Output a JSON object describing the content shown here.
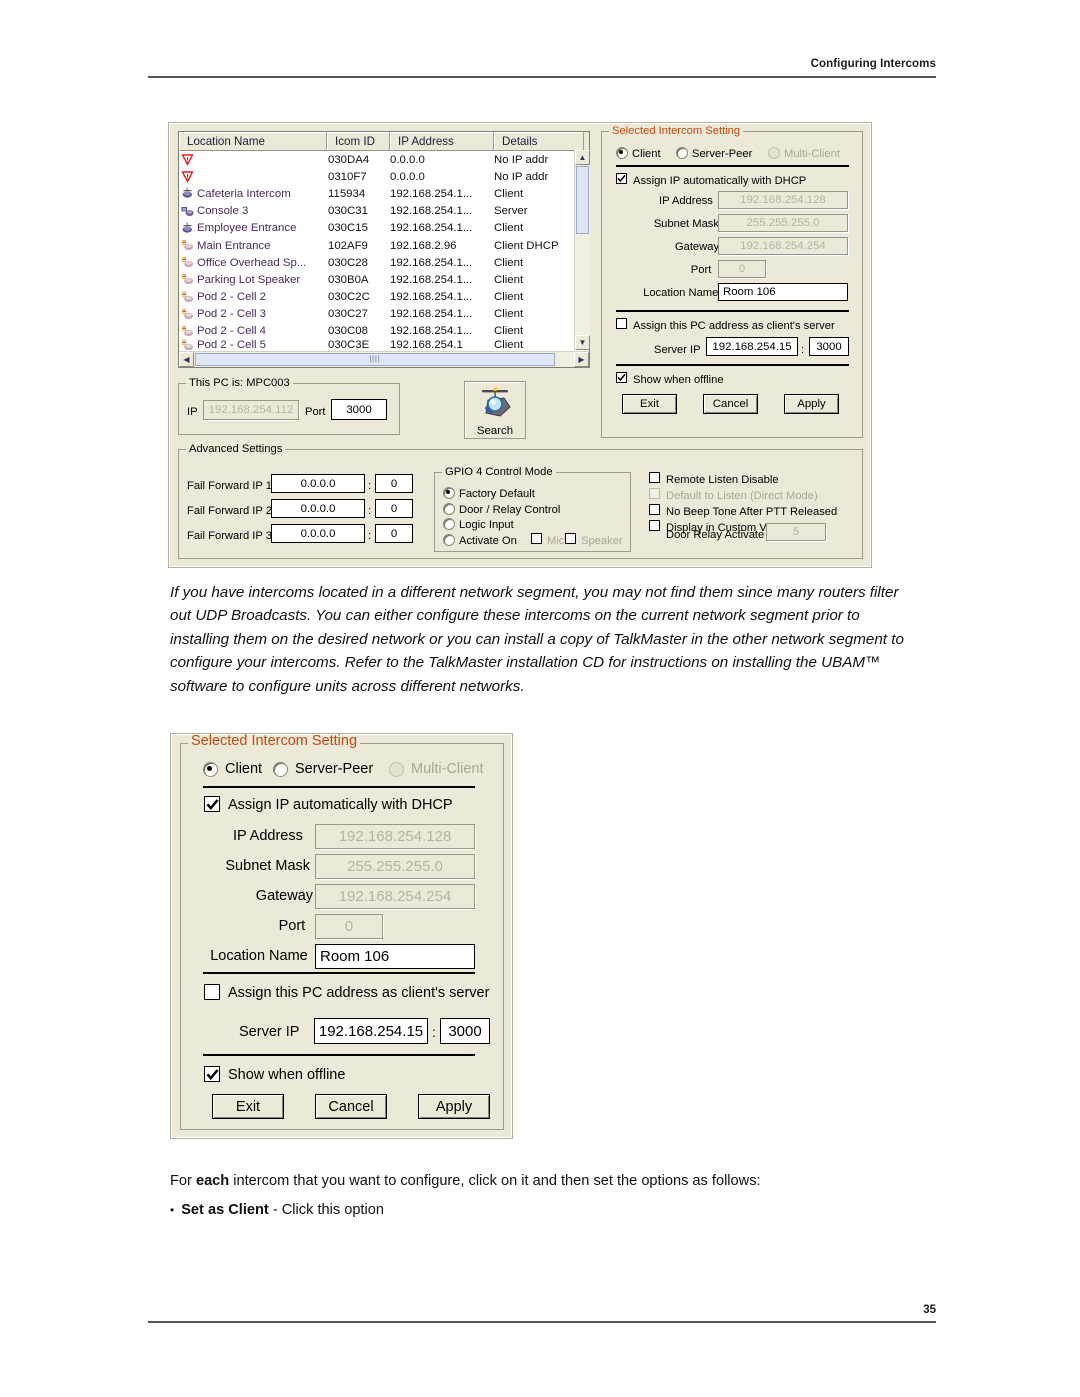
{
  "header": {
    "title": "Configuring Intercoms"
  },
  "footer": {
    "page_number": "35"
  },
  "body": {
    "paragraph_1": "If you have intercoms located in a different network segment, you may not find them since many routers filter out UDP Broadcasts.  You can either configure these intercoms on the current network segment prior to installing them on the desired network or you can install a copy of TalkMaster in the other network segment to configure your intercoms. Refer to the TalkMaster installation CD for instructions on installing the UBAM™ software to configure units across different networks.",
    "paragraph_2_pre": "For ",
    "paragraph_2_bold": "each",
    "paragraph_2_post": " intercom that you want to configure, click on it and then set the options as follows:",
    "bullet_1_bold": "Set as Client",
    "bullet_1_rest": " - Click this option",
    "bullet_dot": "•"
  },
  "intercom_list": {
    "columns": [
      "Location Name",
      "Icom ID",
      "IP Address",
      "Details"
    ],
    "rows": [
      {
        "icon": "warning-triangle-icon",
        "name": "",
        "id": "030DA4",
        "ip": "0.0.0.0",
        "details": "No IP addr"
      },
      {
        "icon": "warning-triangle-icon",
        "name": "",
        "id": "0310F7",
        "ip": "0.0.0.0",
        "details": "No IP addr"
      },
      {
        "icon": "intercom-blue-icon",
        "name": "Cafeteria Intercom",
        "id": "115934",
        "ip": "192.168.254.1...",
        "details": "Client"
      },
      {
        "icon": "console-icon",
        "name": "Console 3",
        "id": "030C31",
        "ip": "192.168.254.1...",
        "details": "Server"
      },
      {
        "icon": "intercom-blue-icon",
        "name": "Employee Entrance",
        "id": "030C15",
        "ip": "192.168.254.1...",
        "details": "Client"
      },
      {
        "icon": "speaker-pink-icon",
        "name": "Main Entrance",
        "id": "102AF9",
        "ip": "192.168.2.96",
        "details": "Client DHCP"
      },
      {
        "icon": "speaker-pink-icon",
        "name": "Office Overhead Sp...",
        "id": "030C28",
        "ip": "192.168.254.1...",
        "details": "Client"
      },
      {
        "icon": "speaker-pink-icon",
        "name": "Parking Lot Speaker",
        "id": "030B0A",
        "ip": "192.168.254.1...",
        "details": "Client"
      },
      {
        "icon": "speaker-pink-icon",
        "name": "Pod 2 - Cell 2",
        "id": "030C2C",
        "ip": "192.168.254.1...",
        "details": "Client"
      },
      {
        "icon": "speaker-pink-icon",
        "name": "Pod 2 - Cell 3",
        "id": "030C27",
        "ip": "192.168.254.1...",
        "details": "Client"
      },
      {
        "icon": "speaker-pink-icon",
        "name": "Pod 2 - Cell 4",
        "id": "030C08",
        "ip": "192.168.254.1...",
        "details": "Client"
      },
      {
        "icon": "speaker-pink-icon",
        "name": "Pod 2 - Cell 5",
        "id": "030C3E",
        "ip": "192.168.254.1",
        "details": "Client"
      }
    ]
  },
  "this_pc": {
    "caption": "This PC is: MPC003",
    "ip_label": "IP",
    "ip_value": "192.168.254.112",
    "port_label": "Port",
    "port_value": "3000"
  },
  "search": {
    "label": "Search",
    "icon": "search-radar-icon"
  },
  "advanced": {
    "caption": "Advanced Settings",
    "fail_forward": [
      {
        "label": "Fail Forward IP 1",
        "ip": "0.0.0.0",
        "sep": ":",
        "port": "0"
      },
      {
        "label": "Fail Forward IP 2",
        "ip": "0.0.0.0",
        "sep": ":",
        "port": "0"
      },
      {
        "label": "Fail Forward IP 3",
        "ip": "0.0.0.0",
        "sep": ":",
        "port": "0"
      }
    ],
    "gpio": {
      "caption": "GPIO 4 Control Mode",
      "options": [
        "Factory Default",
        "Door / Relay Control",
        "Logic Input",
        "Activate On"
      ],
      "selected": "Factory Default",
      "mic_label": "Mic",
      "speaker_label": "Speaker"
    },
    "checks": [
      {
        "label": "Remote Listen Disable",
        "checked": false,
        "disabled": false
      },
      {
        "label": "Default to Listen (Direct Mode)",
        "checked": false,
        "disabled": true
      },
      {
        "label": "No Beep Tone After PTT Released",
        "checked": false,
        "disabled": false
      },
      {
        "label": "Display in Custom View Tab",
        "checked": false,
        "disabled": false
      }
    ],
    "door_relay_label": "Door Relay Activate",
    "door_relay_value": "5"
  },
  "intercom_setting": {
    "caption": "Selected Intercom Setting",
    "caption_color": "#c64a10",
    "modes": [
      {
        "label": "Client",
        "selected": true,
        "disabled": false
      },
      {
        "label": "Server-Peer",
        "selected": false,
        "disabled": false
      },
      {
        "label": "Multi-Client",
        "selected": false,
        "disabled": true
      }
    ],
    "dhcp_label": "Assign IP automatically with  DHCP",
    "dhcp_checked": true,
    "fields": [
      {
        "label": "IP Address",
        "value": "192.168.254.128",
        "disabled": true
      },
      {
        "label": "Subnet Mask",
        "value": "255.255.255.0",
        "disabled": true
      },
      {
        "label": "Gateway",
        "value": "192.168.254.254",
        "disabled": true
      },
      {
        "label": "Port",
        "value": "0",
        "disabled": true
      },
      {
        "label": "Location Name",
        "value": "Room 106",
        "disabled": false
      }
    ],
    "pc_server_label": "Assign this PC address as client's server",
    "pc_server_checked": false,
    "server_ip_label": "Server IP",
    "server_ip_value": "192.168.254.15",
    "server_ip_sep": ":",
    "server_port_value": "3000",
    "show_offline_label": "Show when offline",
    "show_offline_checked": true,
    "buttons": [
      "Exit",
      "Cancel",
      "Apply"
    ]
  }
}
